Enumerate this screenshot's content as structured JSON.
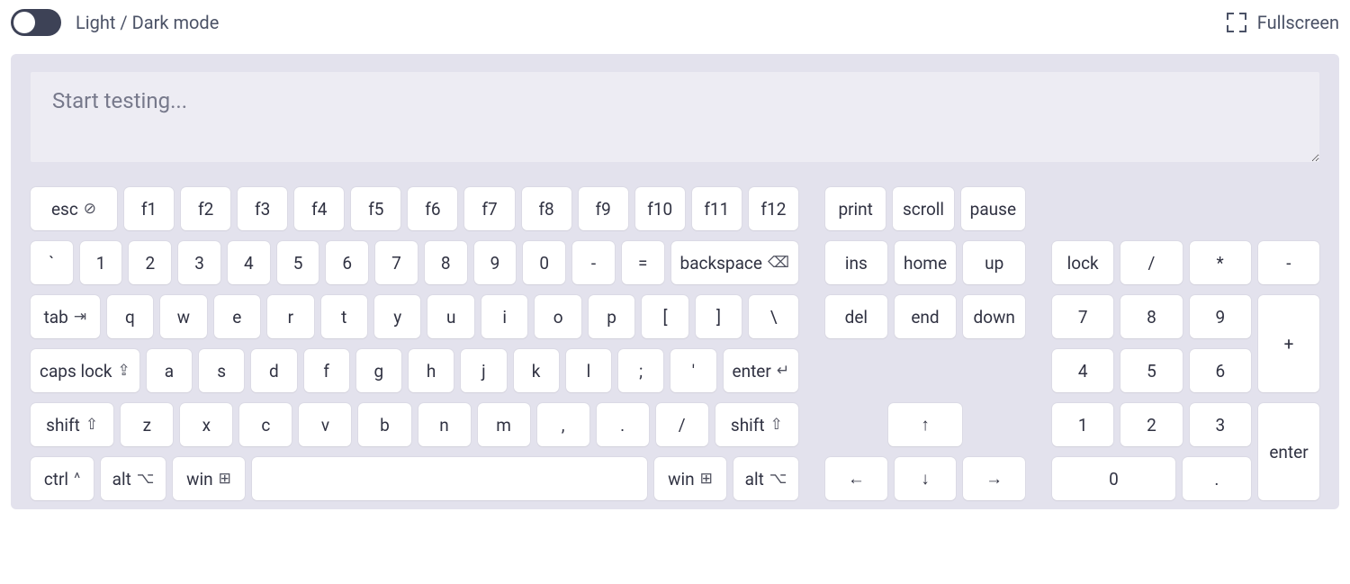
{
  "header": {
    "mode_label": "Light / Dark mode",
    "fullscreen_label": "Fullscreen"
  },
  "input": {
    "placeholder": "Start testing..."
  },
  "keys": {
    "esc": "esc",
    "esc_glyph": "⊘",
    "f1": "f1",
    "f2": "f2",
    "f3": "f3",
    "f4": "f4",
    "f5": "f5",
    "f6": "f6",
    "f7": "f7",
    "f8": "f8",
    "f9": "f9",
    "f10": "f10",
    "f11": "f11",
    "f12": "f12",
    "print": "print",
    "scroll": "scroll",
    "pause": "pause",
    "backtick": "`",
    "k1": "1",
    "k2": "2",
    "k3": "3",
    "k4": "4",
    "k5": "5",
    "k6": "6",
    "k7": "7",
    "k8": "8",
    "k9": "9",
    "k0": "0",
    "minus": "-",
    "equal": "=",
    "backspace": "backspace",
    "backspace_glyph": "⌫",
    "ins": "ins",
    "home": "home",
    "pgup": "up",
    "lock": "lock",
    "numdiv": "/",
    "nummul": "*",
    "numminus": "-",
    "tab": "tab",
    "tab_glyph": "⇥",
    "q": "q",
    "w": "w",
    "e": "e",
    "r": "r",
    "t": "t",
    "y": "y",
    "u": "u",
    "i": "i",
    "o": "o",
    "p": "p",
    "lbr": "[",
    "rbr": "]",
    "bslash": "\\",
    "del": "del",
    "end": "end",
    "pgdn": "down",
    "n7": "7",
    "n8": "8",
    "n9": "9",
    "numplus": "+",
    "caps": "caps lock",
    "caps_glyph": "⇪",
    "a": "a",
    "s": "s",
    "d": "d",
    "f": "f",
    "g": "g",
    "h": "h",
    "j": "j",
    "k": "k",
    "l": "l",
    "semi": ";",
    "quote": "'",
    "enter": "enter",
    "enter_glyph": "↵",
    "n4": "4",
    "n5": "5",
    "n6": "6",
    "shift": "shift",
    "shift_glyph": "⇧",
    "z": "z",
    "x": "x",
    "c": "c",
    "v": "v",
    "b": "b",
    "n": "n",
    "m": "m",
    "comma": ",",
    "dot": ".",
    "slash": "/",
    "arrow_up": "↑",
    "n1": "1",
    "n2": "2",
    "n3": "3",
    "numenter": "enter",
    "ctrl": "ctrl",
    "ctrl_glyph": "^",
    "alt": "alt",
    "alt_glyph": "⌥",
    "win": "win",
    "win_glyph": "⊞",
    "arrow_left": "←",
    "arrow_down": "↓",
    "arrow_right": "→",
    "num0": "0",
    "numdot": "."
  }
}
